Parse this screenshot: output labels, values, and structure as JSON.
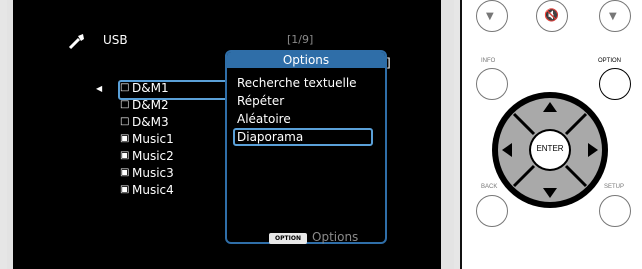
{
  "screen": {
    "source_label": "USB",
    "page_indicator": "[1/9]",
    "items": [
      {
        "label": "D&M1",
        "type": "folder"
      },
      {
        "label": "D&M2",
        "type": "folder"
      },
      {
        "label": "D&M3",
        "type": "folder"
      },
      {
        "label": "Music1",
        "type": "file"
      },
      {
        "label": "Music2",
        "type": "file"
      },
      {
        "label": "Music3",
        "type": "file"
      },
      {
        "label": "Music4",
        "type": "file"
      }
    ],
    "options_popup": {
      "title": "Options",
      "items": [
        "Recherche textuelle",
        "Répéter",
        "Aléatoire",
        "Diaporama"
      ],
      "selected_index": 3
    },
    "hint": {
      "badge": "OPTION",
      "label": "Options"
    }
  },
  "remote": {
    "labels": {
      "info": "INFO",
      "option": "OPTION",
      "back": "BACK",
      "setup": "SETUP",
      "enter": "ENTER"
    }
  },
  "colors": {
    "highlight": "#5aa0d8",
    "popup_header": "#2f6ea8",
    "dpad": "#a9a9a9"
  }
}
